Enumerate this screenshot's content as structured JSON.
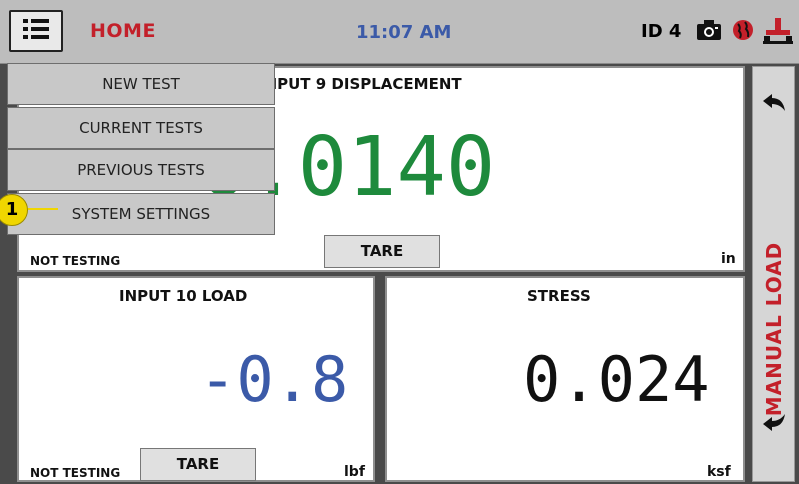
{
  "topbar": {
    "menu_icon": "hamburger-menu-icon",
    "title": "HOME",
    "time": "11:07 AM",
    "device_id": "ID 4",
    "icons": [
      "camera-icon",
      "globe-icon",
      "load-frame-icon"
    ]
  },
  "dropdown": {
    "items": [
      "NEW TEST",
      "CURRENT TESTS",
      "PREVIOUS TESTS",
      "SYSTEM SETTINGS"
    ],
    "callout": "1"
  },
  "panels": {
    "displacement": {
      "title": "INPUT 9 DISPLACEMENT",
      "value": "0.0140",
      "unit": "in",
      "status": "NOT TESTING",
      "tare": "TARE",
      "color": "#1e8a3c"
    },
    "load": {
      "title": "INPUT 10 LOAD",
      "value": "-0.8",
      "unit": "lbf",
      "status": "NOT TESTING",
      "tare": "TARE",
      "color": "#3b5aa8"
    },
    "stress": {
      "title": "STRESS",
      "value": "0.024",
      "unit": "ksf",
      "color": "#111111"
    }
  },
  "side": {
    "label": "MANUAL LOAD",
    "up_icon": "arrow-back-up-icon",
    "down_icon": "arrow-back-down-icon"
  },
  "colors": {
    "accent_red": "#c3202a",
    "time_blue": "#3b5aa8",
    "value_green": "#1e8a3c",
    "callout_yellow": "#f0d600"
  }
}
